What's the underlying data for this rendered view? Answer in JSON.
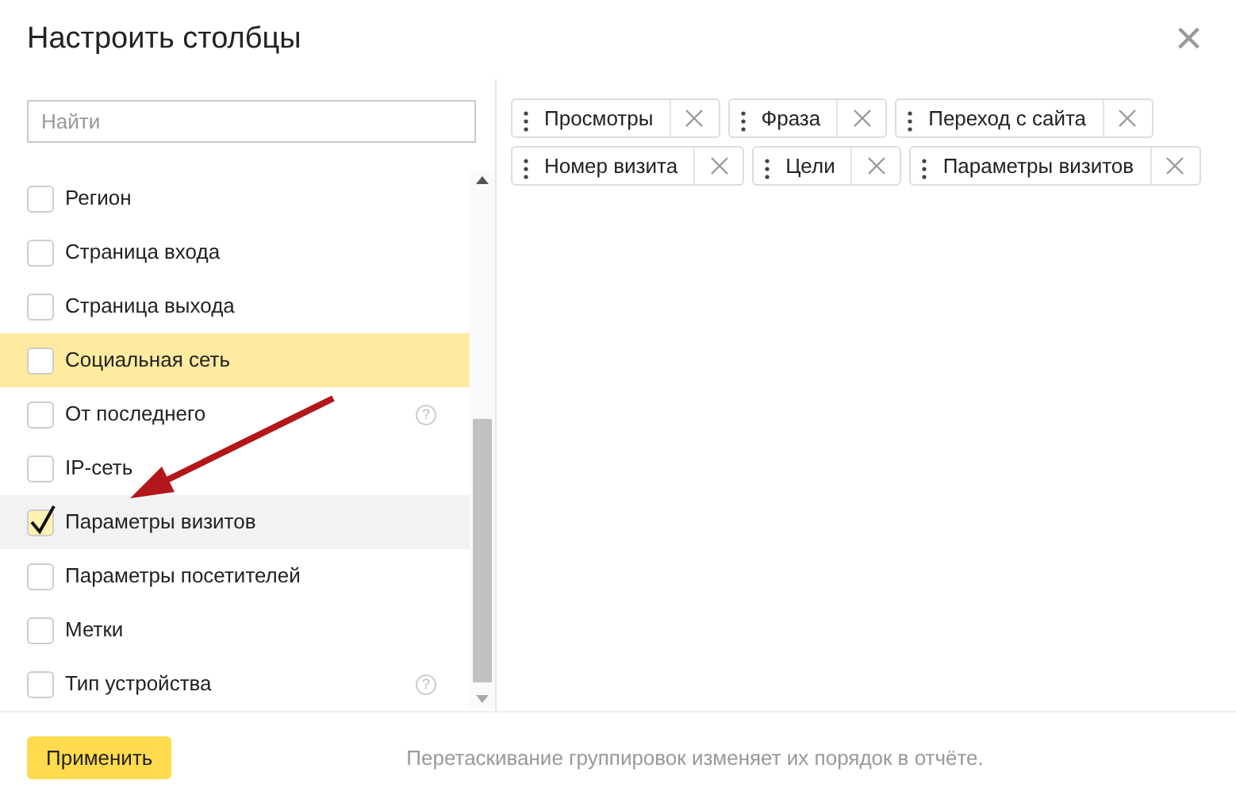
{
  "dialog": {
    "title": "Настроить столбцы",
    "close_icon": "×"
  },
  "search": {
    "placeholder": "Найти"
  },
  "items": [
    {
      "label": "Регион",
      "checked": false,
      "highlighted": false
    },
    {
      "label": "Страница входа",
      "checked": false,
      "highlighted": false
    },
    {
      "label": "Страница выхода",
      "checked": false,
      "highlighted": false
    },
    {
      "label": "Социальная сеть",
      "checked": false,
      "highlighted": true
    },
    {
      "label": "От последнего",
      "checked": false,
      "highlighted": false,
      "help": "?"
    },
    {
      "label": "IP-сеть",
      "checked": false,
      "highlighted": false
    },
    {
      "label": "Параметры визитов",
      "checked": true,
      "highlighted": false
    },
    {
      "label": "Параметры посетителей",
      "checked": false,
      "highlighted": false
    },
    {
      "label": "Метки",
      "checked": false,
      "highlighted": false
    },
    {
      "label": "Тип устройства",
      "checked": false,
      "highlighted": false,
      "help": "?"
    }
  ],
  "chips": [
    [
      "Просмотры",
      "Фраза",
      "Переход с сайта"
    ],
    [
      "Номер визита",
      "Цели",
      "Параметры визитов"
    ]
  ],
  "footer": {
    "apply_button": "Применить",
    "hint": "Перетаскивание группировок изменяет их порядок в отчёте."
  }
}
